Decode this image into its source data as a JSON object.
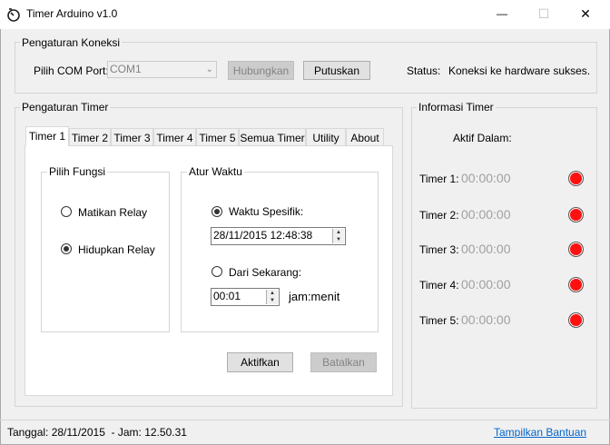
{
  "window": {
    "title": "Timer Arduino v1.0",
    "minimize": "—",
    "maximize": "☐",
    "close": "✕"
  },
  "connection": {
    "group_title": "Pengaturan Koneksi",
    "port_label": "Pilih COM Port:",
    "port_value": "COM1",
    "connect_label": "Hubungkan",
    "disconnect_label": "Putuskan",
    "status_label": "Status:",
    "status_value": "Koneksi ke hardware sukses."
  },
  "timer_settings": {
    "group_title": "Pengaturan Timer",
    "tabs": [
      "Timer 1",
      "Timer 2",
      "Timer 3",
      "Timer 4",
      "Timer 5",
      "Semua Timer",
      "Utility",
      "About"
    ],
    "active_tab": "Timer 1",
    "function_group": {
      "title": "Pilih Fungsi",
      "options": [
        "Matikan Relay",
        "Hidupkan Relay"
      ],
      "selected": "Hidupkan Relay"
    },
    "time_group": {
      "title": "Atur Waktu",
      "specific_label": "Waktu Spesifik:",
      "specific_value": "28/11/2015 12:48:38",
      "from_now_label": "Dari Sekarang:",
      "from_now_value": "00:01",
      "unit_label": "jam:menit",
      "selected": "Waktu Spesifik:"
    },
    "activate_label": "Aktifkan",
    "cancel_label": "Batalkan"
  },
  "timer_info": {
    "group_title": "Informasi Timer",
    "active_in_label": "Aktif Dalam:",
    "timers": [
      {
        "label": "Timer 1:",
        "time": "00:00:00",
        "status_color": "#ff1010"
      },
      {
        "label": "Timer 2:",
        "time": "00:00:00",
        "status_color": "#ff1010"
      },
      {
        "label": "Timer 3:",
        "time": "00:00:00",
        "status_color": "#ff1010"
      },
      {
        "label": "Timer 4:",
        "time": "00:00:00",
        "status_color": "#ff1010"
      },
      {
        "label": "Timer 5:",
        "time": "00:00:00",
        "status_color": "#ff1010"
      }
    ]
  },
  "statusbar": {
    "datetime": "Tanggal: 28/11/2015  - Jam: 12.50.31",
    "help_link": "Tampilkan Bantuan"
  }
}
